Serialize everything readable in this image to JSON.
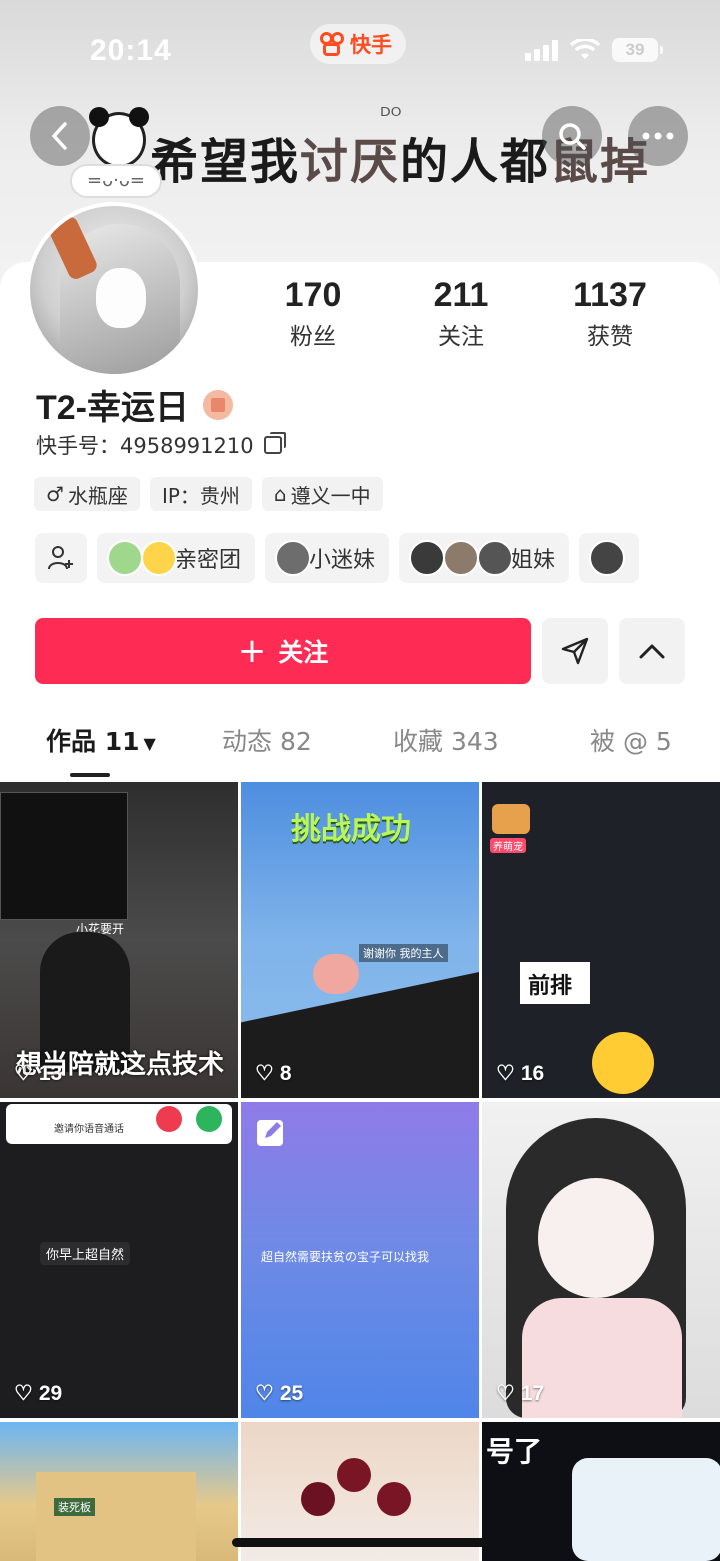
{
  "status_bar": {
    "time": "20:14",
    "app_name": "快手",
    "battery": "39"
  },
  "banner": {
    "text_main": "希望我",
    "text_accent": "讨厌",
    "text_rest": "的人都",
    "text_accent2": "鼠掉",
    "decor_left": "ᴰᴼ",
    "avatar_frame_text": "=ᴗ·ᴗ="
  },
  "nav": {
    "back_icon": "chevron-left-icon",
    "search_icon": "search-icon",
    "more_icon": "more-icon"
  },
  "stats": [
    {
      "value": "170",
      "label": "粉丝"
    },
    {
      "value": "211",
      "label": "关注"
    },
    {
      "value": "1137",
      "label": "获赞"
    }
  ],
  "profile": {
    "name": "T2-幸运日",
    "id_text": "快手号：4958991210",
    "tags": [
      {
        "icon": "♂",
        "label": "水瓶座"
      },
      {
        "icon": "",
        "label": "IP：贵州"
      },
      {
        "icon": "⌂",
        "label": "遵义一中"
      }
    ],
    "groups": [
      {
        "label": "亲密团"
      },
      {
        "label": "小迷妹"
      },
      {
        "label": "姐妹"
      }
    ]
  },
  "actions": {
    "follow_label": "关注",
    "follow_plus": "+"
  },
  "tabs": [
    {
      "label": "作品 11",
      "active": true
    },
    {
      "label": "动态 82",
      "active": false
    },
    {
      "label": "收藏 343",
      "active": false
    },
    {
      "label": "被 @ 5",
      "active": false
    }
  ],
  "posts": [
    {
      "likes": "13",
      "caption": "想当陪就这点技术",
      "sub": "小花要开"
    },
    {
      "likes": "8",
      "caption": "挑战成功",
      "sub": "谢谢你 我的主人"
    },
    {
      "likes": "16",
      "caption": "前排",
      "sub": "养萌宠"
    },
    {
      "likes": "29",
      "caption": "你早上超自然",
      "sub": "邀请你语音通话"
    },
    {
      "likes": "25",
      "caption": "超自然需要扶贫の宝子可以找我",
      "sub": ""
    },
    {
      "likes": "17",
      "caption": "",
      "sub": ""
    },
    {
      "likes": "",
      "caption": "装死板",
      "sub": ""
    },
    {
      "likes": "",
      "caption": "",
      "sub": ""
    },
    {
      "likes": "",
      "caption": "号了",
      "sub": ""
    }
  ],
  "colors": {
    "accent": "#fe2c55",
    "brand": "#ff4b1f"
  }
}
